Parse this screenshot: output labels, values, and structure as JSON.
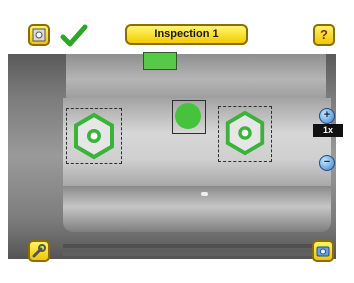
{
  "header": {
    "title": "Inspection 1",
    "status_icon": "check-icon",
    "left_button_icon": "frame-icon",
    "help_button_icon": "help-icon"
  },
  "zoom": {
    "level": "1x",
    "zoom_in_icon": "zoom-in-icon",
    "zoom_out_icon": "zoom-out-icon"
  },
  "footer": {
    "left_button_icon": "wrench-icon",
    "right_button_icon": "camera-icon"
  },
  "colors": {
    "accent_yellow": "#f2cc00",
    "pass_green": "#58c84a",
    "check_green": "#2fa52a"
  }
}
